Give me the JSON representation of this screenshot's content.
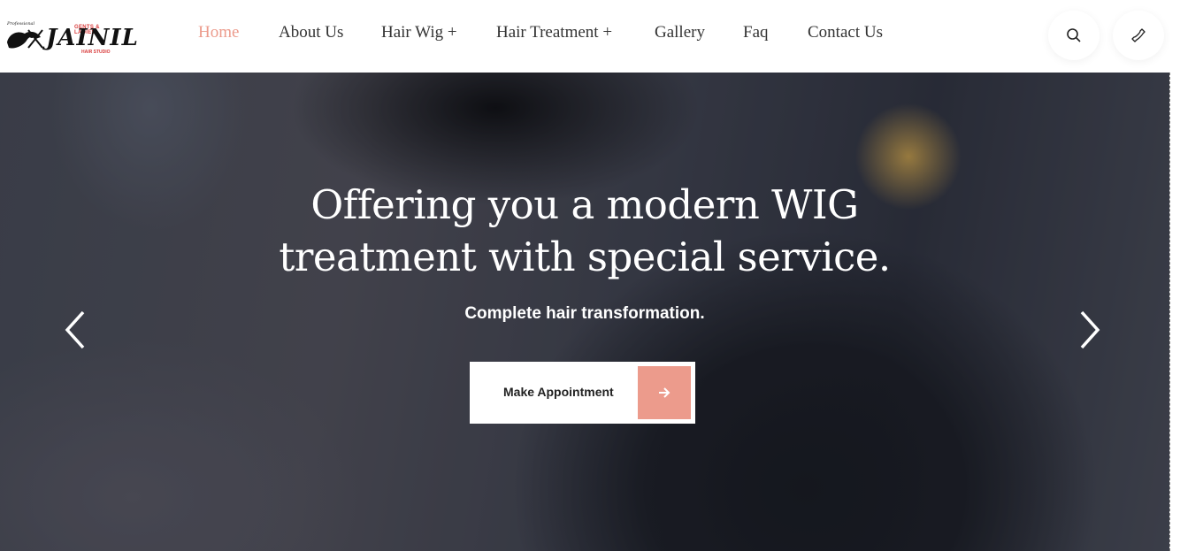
{
  "brand": {
    "top_text": "Professional",
    "name": "JAINIL",
    "tagline": "GENTS & LADIES",
    "subtitle": "HAIR STUDIO"
  },
  "nav": {
    "items": [
      {
        "label": "Home",
        "active": true
      },
      {
        "label": "About Us"
      },
      {
        "label": "Hair Wig +"
      },
      {
        "label": "Hair Treatment +"
      },
      {
        "label": "Gallery"
      },
      {
        "label": "Faq"
      },
      {
        "label": "Contact Us"
      }
    ]
  },
  "header_icons": [
    "search-icon",
    "phone-icon"
  ],
  "hero": {
    "title_line1": "Offering you a modern WIG",
    "title_line2": "treatment with special service.",
    "subtitle": "Complete hair transformation.",
    "cta_label": "Make Appointment",
    "prev_icon": "chevron-left-icon",
    "next_icon": "chevron-right-icon"
  },
  "colors": {
    "accent": "#ec9b8c",
    "text_dark": "#333333"
  }
}
